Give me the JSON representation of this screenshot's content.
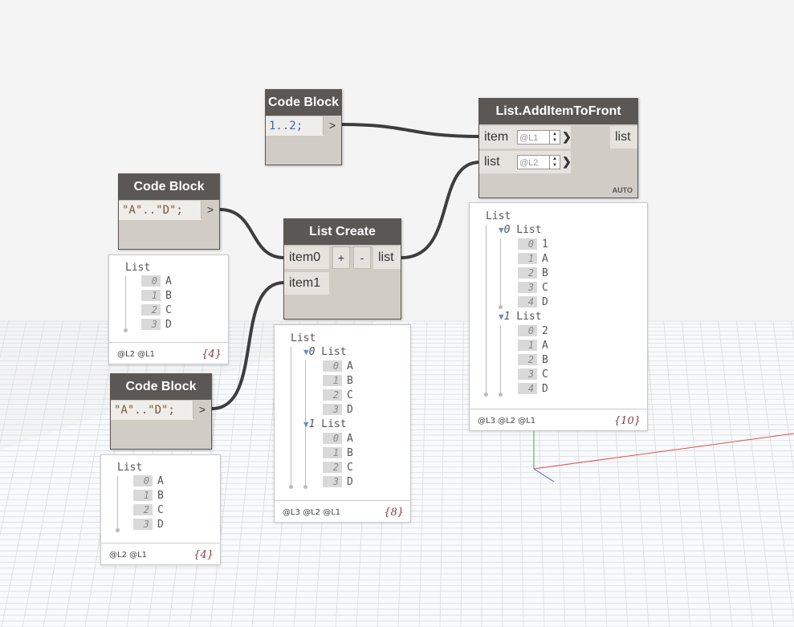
{
  "colors": {
    "wire": "#3d3d3d",
    "header": "#5b5755",
    "node_body": "#d1ccc5",
    "grid": "#d8dde2",
    "axis_x": "#e05050",
    "axis_y": "#50a050",
    "axis_z": "#5050e0"
  },
  "nodes": {
    "cb_top": {
      "title": "Code Block",
      "code": "1..2;",
      "out": ">"
    },
    "cb_mid": {
      "title": "Code Block",
      "code": "\"A\"..\"D\";",
      "out": ">"
    },
    "cb_low": {
      "title": "Code Block",
      "code": "\"A\"..\"D\";",
      "out": ">"
    },
    "list_create": {
      "title": "List Create",
      "in0": "item0",
      "in1": "item1",
      "add": "+",
      "remove": "-",
      "out": "list"
    },
    "add_front": {
      "title": "List.AddItemToFront",
      "in_item": "item",
      "in_list": "list",
      "item_level": "@L1",
      "list_level": "@L2",
      "out": "list",
      "mode": "AUTO"
    }
  },
  "previews": {
    "mid": {
      "root": "List",
      "items": [
        {
          "i": "0",
          "v": "A"
        },
        {
          "i": "1",
          "v": "B"
        },
        {
          "i": "2",
          "v": "C"
        },
        {
          "i": "3",
          "v": "D"
        }
      ],
      "levels": "@L2 @L1",
      "count": "{4}"
    },
    "low": {
      "root": "List",
      "items": [
        {
          "i": "0",
          "v": "A"
        },
        {
          "i": "1",
          "v": "B"
        },
        {
          "i": "2",
          "v": "C"
        },
        {
          "i": "3",
          "v": "D"
        }
      ],
      "levels": "@L2 @L1",
      "count": "{4}"
    },
    "create": {
      "root": "List",
      "sub0_index": "0",
      "sub0_label": "List",
      "sub0": [
        {
          "i": "0",
          "v": "A"
        },
        {
          "i": "1",
          "v": "B"
        },
        {
          "i": "2",
          "v": "C"
        },
        {
          "i": "3",
          "v": "D"
        }
      ],
      "sub1_index": "1",
      "sub1_label": "List",
      "sub1": [
        {
          "i": "0",
          "v": "A"
        },
        {
          "i": "1",
          "v": "B"
        },
        {
          "i": "2",
          "v": "C"
        },
        {
          "i": "3",
          "v": "D"
        }
      ],
      "levels": "@L3 @L2 @L1",
      "count": "{8}"
    },
    "front": {
      "root": "List",
      "sub0_index": "0",
      "sub0_label": "List",
      "sub0": [
        {
          "i": "0",
          "v": "1"
        },
        {
          "i": "1",
          "v": "A"
        },
        {
          "i": "2",
          "v": "B"
        },
        {
          "i": "3",
          "v": "C"
        },
        {
          "i": "4",
          "v": "D"
        }
      ],
      "sub1_index": "1",
      "sub1_label": "List",
      "sub1": [
        {
          "i": "0",
          "v": "2"
        },
        {
          "i": "1",
          "v": "A"
        },
        {
          "i": "2",
          "v": "B"
        },
        {
          "i": "3",
          "v": "C"
        },
        {
          "i": "4",
          "v": "D"
        }
      ],
      "levels": "@L3 @L2 @L1",
      "count": "{10}"
    }
  }
}
